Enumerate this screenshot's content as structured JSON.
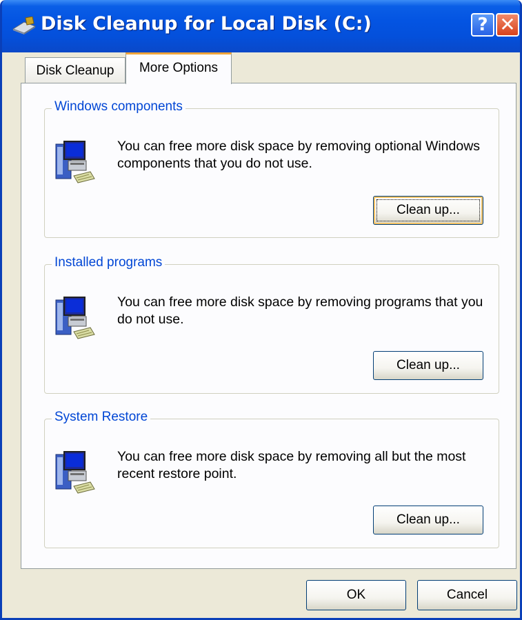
{
  "window": {
    "title": "Disk Cleanup for Local Disk (C:)",
    "help_glyph": "?",
    "close_glyph": "✕"
  },
  "tabs": [
    {
      "label": "Disk Cleanup",
      "active": false
    },
    {
      "label": "More Options",
      "active": true
    }
  ],
  "groups": [
    {
      "title": "Windows components",
      "description": "You can free more disk space by removing optional Windows components that you do not use.",
      "button_label": "Clean up...",
      "focused": true
    },
    {
      "title": "Installed programs",
      "description": "You can free more disk space by removing programs that you do not use.",
      "button_label": "Clean up...",
      "focused": false
    },
    {
      "title": "System Restore",
      "description": "You can free more disk space by removing all but the most recent restore point.",
      "button_label": "Clean up...",
      "focused": false
    }
  ],
  "footer": {
    "ok_label": "OK",
    "cancel_label": "Cancel"
  },
  "icons": {
    "title": "disk-cleanup-icon",
    "group": "computer-install-icon"
  },
  "colors": {
    "titlebar": "#0454e2",
    "group_title": "#0046d5",
    "active_tab_highlight": "#f0a43a",
    "close_button": "#d8421c"
  }
}
